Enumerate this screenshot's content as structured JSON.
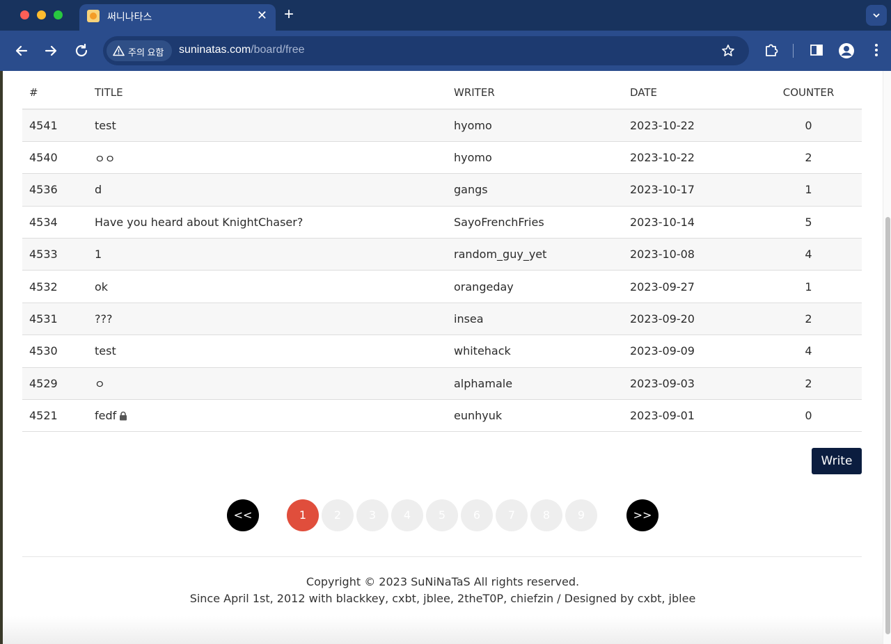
{
  "browser": {
    "tab_title": "써니나타스",
    "tab_close": "✕",
    "new_tab": "+",
    "tab_search": "⌄",
    "security_chip": "주의 요함",
    "url_host": "suninatas.com",
    "url_path": "/board/free"
  },
  "board": {
    "headers": {
      "no": "#",
      "title": "TITLE",
      "writer": "WRITER",
      "date": "DATE",
      "counter": "COUNTER"
    },
    "rows": [
      {
        "no": "4541",
        "title": "test",
        "writer": "hyomo",
        "date": "2023-10-22",
        "counter": "0"
      },
      {
        "no": "4540",
        "title": "ㅇㅇ",
        "writer": "hyomo",
        "date": "2023-10-22",
        "counter": "2"
      },
      {
        "no": "4536",
        "title": "d",
        "writer": "gangs",
        "date": "2023-10-17",
        "counter": "1"
      },
      {
        "no": "4534",
        "title": "Have you heard about KnightChaser?",
        "writer": "SayoFrenchFries",
        "date": "2023-10-14",
        "counter": "5"
      },
      {
        "no": "4533",
        "title": "1",
        "writer": "random_guy_yet",
        "date": "2023-10-08",
        "counter": "4"
      },
      {
        "no": "4532",
        "title": "ok",
        "writer": "orangeday",
        "date": "2023-09-27",
        "counter": "1"
      },
      {
        "no": "4531",
        "title": "???",
        "writer": "insea",
        "date": "2023-09-20",
        "counter": "2"
      },
      {
        "no": "4530",
        "title": "test",
        "writer": "whitehack",
        "date": "2023-09-09",
        "counter": "4"
      },
      {
        "no": "4529",
        "title": "ㅇ",
        "writer": "alphamale",
        "date": "2023-09-03",
        "counter": "2"
      },
      {
        "no": "4521",
        "title": "fedf",
        "writer": "eunhyuk",
        "date": "2023-09-01",
        "counter": "0",
        "locked": true
      }
    ],
    "write_label": "Write"
  },
  "pagination": {
    "prev": "<<",
    "next": ">>",
    "pages": [
      "1",
      "2",
      "3",
      "4",
      "5",
      "6",
      "7",
      "8",
      "9"
    ],
    "current": "1"
  },
  "footer": {
    "copyright": "Copyright © 2023 SuNiNaTaS All rights reserved.",
    "credits": "Since April 1st, 2012 with blackkey, cxbt, jblee, 2theT0P, chiefzin / Designed by cxbt, jblee"
  },
  "colors": {
    "active_page": "#e04e3c",
    "write_button": "#0b1d3f",
    "browser_frame": "#2a4c8c"
  }
}
